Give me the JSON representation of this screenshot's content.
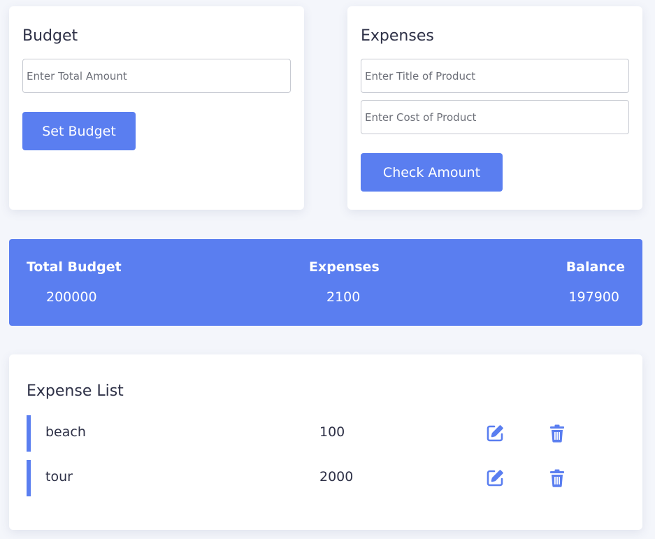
{
  "budget": {
    "title": "Budget",
    "amount_placeholder": "Enter Total Amount",
    "amount_value": "",
    "button_label": "Set Budget"
  },
  "expenses_form": {
    "title": "Expenses",
    "title_placeholder": "Enter Title of Product",
    "title_value": "",
    "cost_placeholder": "Enter Cost of Product",
    "cost_value": "",
    "button_label": "Check Amount"
  },
  "summary": {
    "total_budget_label": "Total Budget",
    "total_budget_value": "200000",
    "expenses_label": "Expenses",
    "expenses_value": "2100",
    "balance_label": "Balance",
    "balance_value": "197900"
  },
  "expense_list": {
    "title": "Expense List",
    "items": [
      {
        "title": "beach",
        "amount": "100"
      },
      {
        "title": "tour",
        "amount": "2000"
      }
    ]
  },
  "colors": {
    "accent": "#5a7ef0",
    "background": "#f4f6fb",
    "card": "#ffffff",
    "text": "#2e3147"
  },
  "icons": {
    "edit": "edit-icon",
    "delete": "trash-icon"
  }
}
